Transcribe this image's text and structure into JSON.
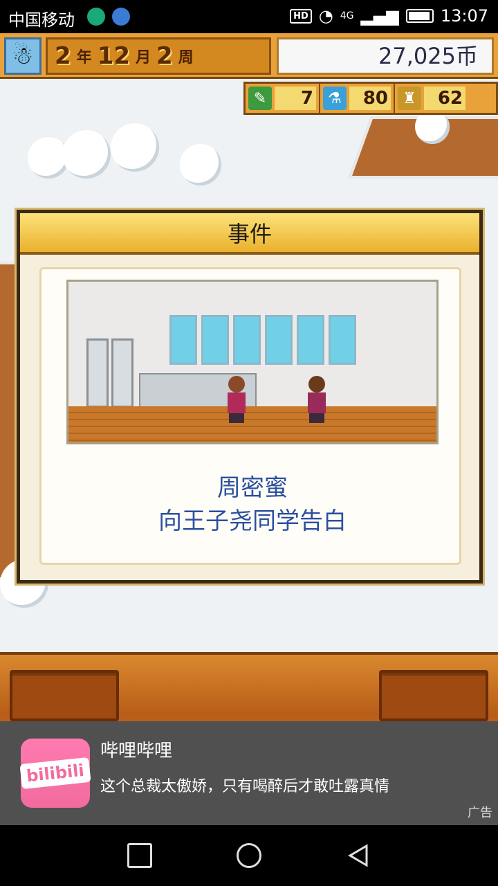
{
  "status": {
    "carrier": "中国移动",
    "net": "4G",
    "hd": "HD",
    "time": "13:07"
  },
  "hud": {
    "year": "2",
    "year_unit": "年",
    "month": "12",
    "month_unit": "月",
    "week": "2",
    "week_unit": "周",
    "money": "27,025币"
  },
  "resources": [
    {
      "icon": "pencil-icon",
      "value": "7"
    },
    {
      "icon": "flask-icon",
      "value": "80"
    },
    {
      "icon": "trophy-icon",
      "value": "62"
    }
  ],
  "dialog": {
    "title": "事件",
    "line1": "周密蜜",
    "line2": "向王子尧同学告白"
  },
  "ad": {
    "app": "哔哩哔哩",
    "logo_text": "bilibili",
    "text": "这个总裁太傲娇，只有喝醉后才敢吐露真情",
    "label": "广告"
  },
  "colors": {
    "accent": "#e9a23a",
    "text_blue": "#2b4fa0"
  }
}
